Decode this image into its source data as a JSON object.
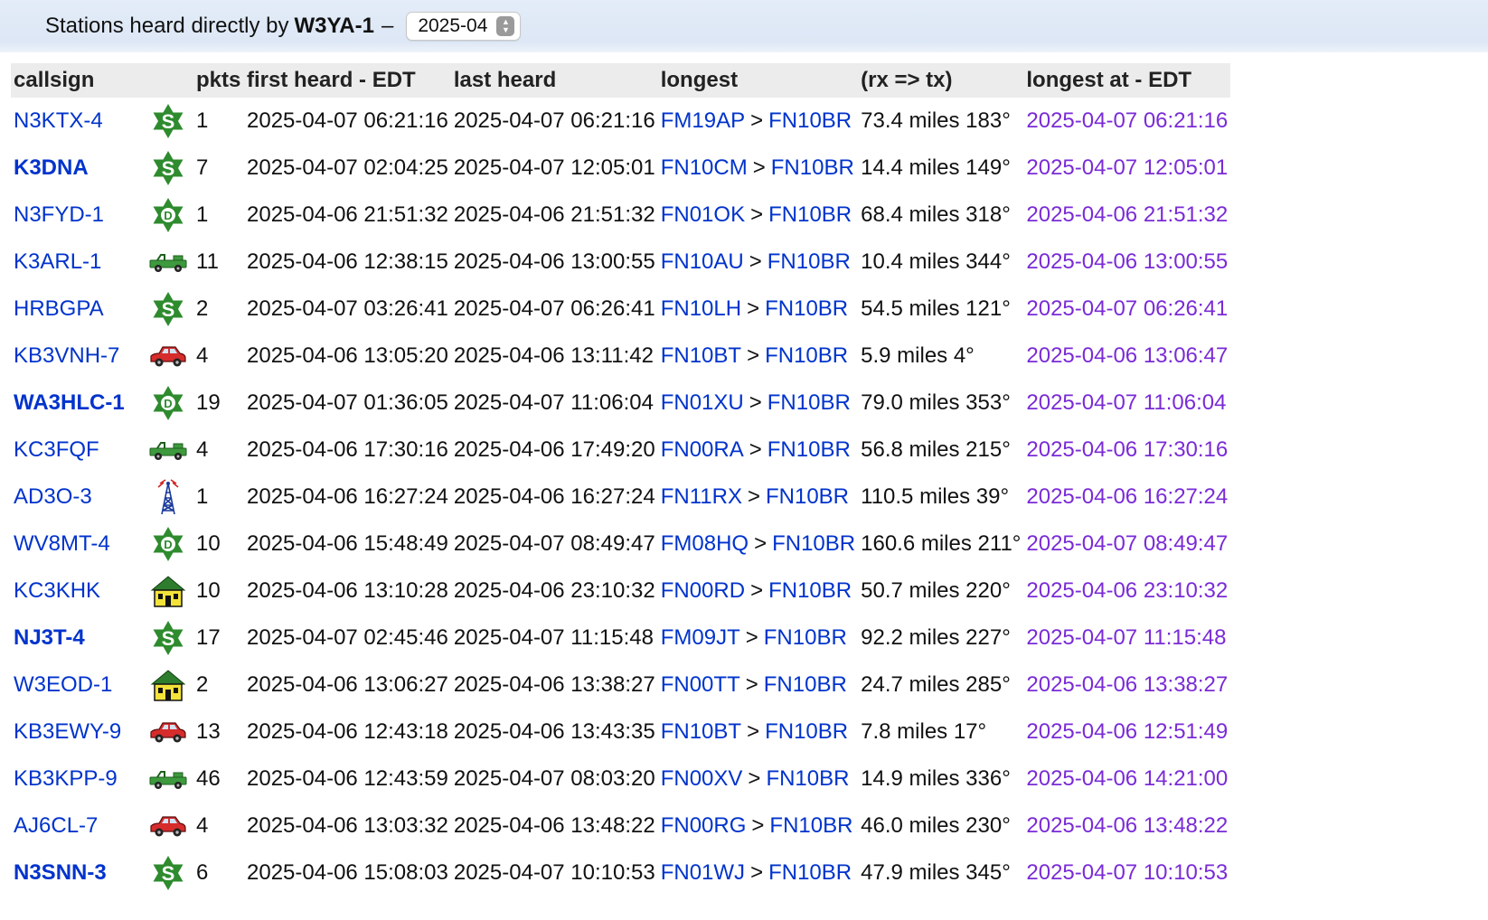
{
  "header": {
    "prefix": "Stations heard directly by",
    "station": "W3YA-1",
    "dash": "–",
    "month": "2025-04"
  },
  "columns": [
    "callsign",
    "pkts",
    "first heard - EDT",
    "last heard",
    "longest",
    "(rx => tx)",
    "longest at - EDT"
  ],
  "icon_legend": {
    "star": "green star with letter S",
    "star-d": "green star with letter D",
    "jeep": "green jeep",
    "car": "red car",
    "tower": "blue radio tower",
    "house": "green house"
  },
  "rows": [
    {
      "call": "N3KTX-4",
      "bold": false,
      "icon": "star",
      "letter": "S",
      "pkts": "1",
      "first": "2025-04-07 06:21:16",
      "last": "2025-04-07 06:21:16",
      "from": "FM19AP",
      "to": "FN10BR",
      "dist": "73.4 miles 183°",
      "at": "2025-04-07 06:21:16"
    },
    {
      "call": "K3DNA",
      "bold": true,
      "icon": "star",
      "letter": "S",
      "pkts": "7",
      "first": "2025-04-07 02:04:25",
      "last": "2025-04-07 12:05:01",
      "from": "FN10CM",
      "to": "FN10BR",
      "dist": "14.4 miles 149°",
      "at": "2025-04-07 12:05:01"
    },
    {
      "call": "N3FYD-1",
      "bold": false,
      "icon": "star",
      "letter": "D",
      "pkts": "1",
      "first": "2025-04-06 21:51:32",
      "last": "2025-04-06 21:51:32",
      "from": "FN01OK",
      "to": "FN10BR",
      "dist": "68.4 miles 318°",
      "at": "2025-04-06 21:51:32"
    },
    {
      "call": "K3ARL-1",
      "bold": false,
      "icon": "jeep",
      "letter": "",
      "pkts": "11",
      "first": "2025-04-06 12:38:15",
      "last": "2025-04-06 13:00:55",
      "from": "FN10AU",
      "to": "FN10BR",
      "dist": "10.4 miles 344°",
      "at": "2025-04-06 13:00:55"
    },
    {
      "call": "HRBGPA",
      "bold": false,
      "icon": "star",
      "letter": "S",
      "pkts": "2",
      "first": "2025-04-07 03:26:41",
      "last": "2025-04-07 06:26:41",
      "from": "FN10LH",
      "to": "FN10BR",
      "dist": "54.5 miles 121°",
      "at": "2025-04-07 06:26:41"
    },
    {
      "call": "KB3VNH-7",
      "bold": false,
      "icon": "car",
      "letter": "",
      "pkts": "4",
      "first": "2025-04-06 13:05:20",
      "last": "2025-04-06 13:11:42",
      "from": "FN10BT",
      "to": "FN10BR",
      "dist": "5.9 miles 4°",
      "at": "2025-04-06 13:06:47"
    },
    {
      "call": "WA3HLC-1",
      "bold": true,
      "icon": "star",
      "letter": "D",
      "pkts": "19",
      "first": "2025-04-07 01:36:05",
      "last": "2025-04-07 11:06:04",
      "from": "FN01XU",
      "to": "FN10BR",
      "dist": "79.0 miles 353°",
      "at": "2025-04-07 11:06:04"
    },
    {
      "call": "KC3FQF",
      "bold": false,
      "icon": "jeep",
      "letter": "",
      "pkts": "4",
      "first": "2025-04-06 17:30:16",
      "last": "2025-04-06 17:49:20",
      "from": "FN00RA",
      "to": "FN10BR",
      "dist": "56.8 miles 215°",
      "at": "2025-04-06 17:30:16"
    },
    {
      "call": "AD3O-3",
      "bold": false,
      "icon": "tower",
      "letter": "",
      "pkts": "1",
      "first": "2025-04-06 16:27:24",
      "last": "2025-04-06 16:27:24",
      "from": "FN11RX",
      "to": "FN10BR",
      "dist": "110.5 miles 39°",
      "at": "2025-04-06 16:27:24"
    },
    {
      "call": "WV8MT-4",
      "bold": false,
      "icon": "star",
      "letter": "D",
      "pkts": "10",
      "first": "2025-04-06 15:48:49",
      "last": "2025-04-07 08:49:47",
      "from": "FM08HQ",
      "to": "FN10BR",
      "dist": "160.6 miles 211°",
      "at": "2025-04-07 08:49:47"
    },
    {
      "call": "KC3KHK",
      "bold": false,
      "icon": "house",
      "letter": "",
      "pkts": "10",
      "first": "2025-04-06 13:10:28",
      "last": "2025-04-06 23:10:32",
      "from": "FN00RD",
      "to": "FN10BR",
      "dist": "50.7 miles 220°",
      "at": "2025-04-06 23:10:32"
    },
    {
      "call": "NJ3T-4",
      "bold": true,
      "icon": "star",
      "letter": "S",
      "pkts": "17",
      "first": "2025-04-07 02:45:46",
      "last": "2025-04-07 11:15:48",
      "from": "FM09JT",
      "to": "FN10BR",
      "dist": "92.2 miles 227°",
      "at": "2025-04-07 11:15:48"
    },
    {
      "call": "W3EOD-1",
      "bold": false,
      "icon": "house",
      "letter": "",
      "pkts": "2",
      "first": "2025-04-06 13:06:27",
      "last": "2025-04-06 13:38:27",
      "from": "FN00TT",
      "to": "FN10BR",
      "dist": "24.7 miles 285°",
      "at": "2025-04-06 13:38:27"
    },
    {
      "call": "KB3EWY-9",
      "bold": false,
      "icon": "car",
      "letter": "",
      "pkts": "13",
      "first": "2025-04-06 12:43:18",
      "last": "2025-04-06 13:43:35",
      "from": "FN10BT",
      "to": "FN10BR",
      "dist": "7.8 miles 17°",
      "at": "2025-04-06 12:51:49"
    },
    {
      "call": "KB3KPP-9",
      "bold": false,
      "icon": "jeep",
      "letter": "",
      "pkts": "46",
      "first": "2025-04-06 12:43:59",
      "last": "2025-04-07 08:03:20",
      "from": "FN00XV",
      "to": "FN10BR",
      "dist": "14.9 miles 336°",
      "at": "2025-04-06 14:21:00"
    },
    {
      "call": "AJ6CL-7",
      "bold": false,
      "icon": "car",
      "letter": "",
      "pkts": "4",
      "first": "2025-04-06 13:03:32",
      "last": "2025-04-06 13:48:22",
      "from": "FN00RG",
      "to": "FN10BR",
      "dist": "46.0 miles 230°",
      "at": "2025-04-06 13:48:22"
    },
    {
      "call": "N3SNN-3",
      "bold": true,
      "icon": "star",
      "letter": "S",
      "pkts": "6",
      "first": "2025-04-06 15:08:03",
      "last": "2025-04-07 10:10:53",
      "from": "FN01WJ",
      "to": "FN10BR",
      "dist": "47.9 miles 345°",
      "at": "2025-04-07 10:10:53"
    }
  ]
}
